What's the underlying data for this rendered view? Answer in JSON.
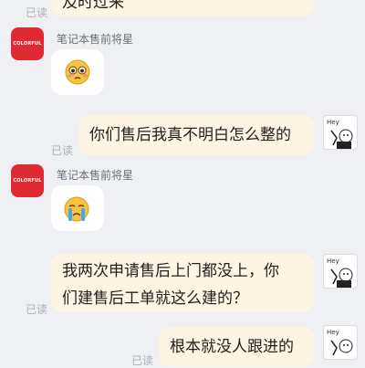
{
  "messages": {
    "top_partial": {
      "text": "及时过来",
      "read": "已读"
    },
    "peer1": {
      "sender": "笔记本售前将星",
      "avatar_text": "COLORFUL",
      "emoji": "flushed-face-emoji"
    },
    "user1": {
      "text": "你们售后我真不明白怎么整的",
      "read": "已读"
    },
    "peer2": {
      "sender": "笔记本售前将星",
      "avatar_text": "COLORFUL",
      "emoji": "crying-face-emoji"
    },
    "user2": {
      "line1": "我两次申请售后上门都没上，你",
      "line2": "们建售后工单就这么建的？",
      "read": "已读"
    },
    "user3": {
      "text": "根本就没人跟进的",
      "read": "已读"
    }
  },
  "colors": {
    "background": "#eef0f3",
    "user_bubble": "#fdf4e3",
    "peer_bubble": "#ffffff",
    "brand_avatar": "#e02a33",
    "read_label": "#aab0b8"
  }
}
